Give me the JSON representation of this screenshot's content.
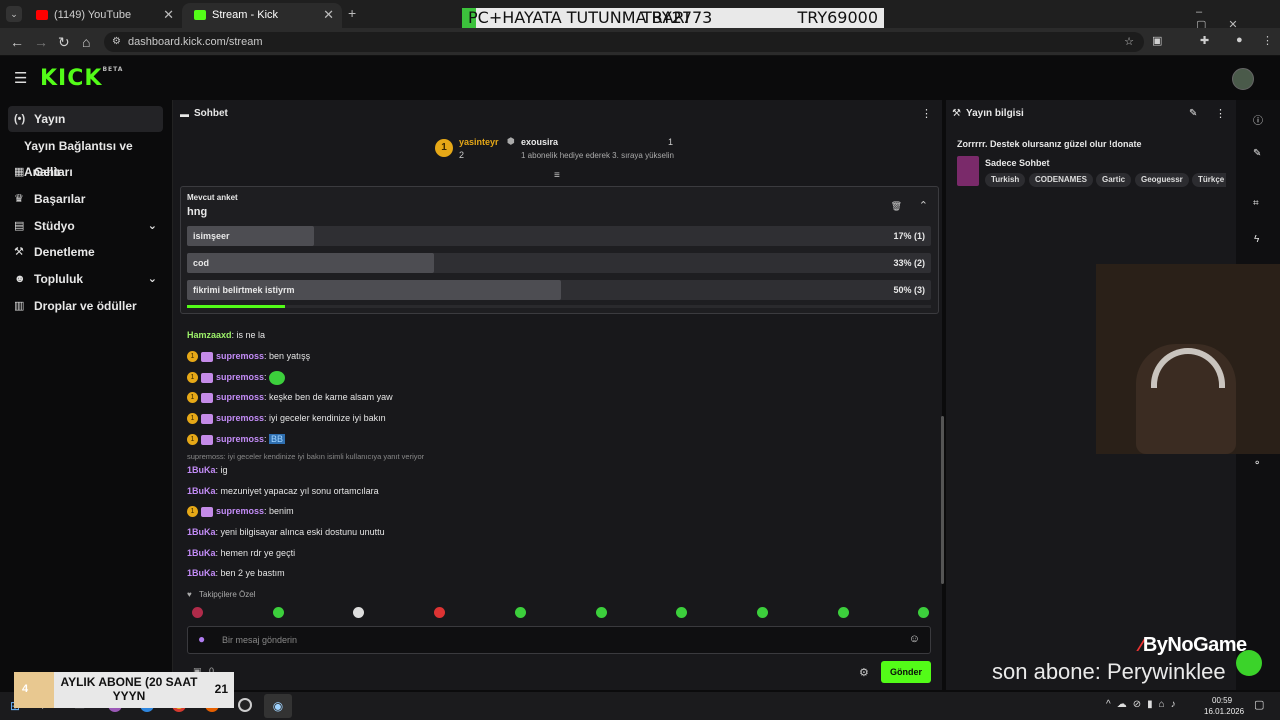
{
  "browser": {
    "tabs": [
      {
        "title": "(1149) YouTube"
      },
      {
        "title": "Stream - Kick Dashboard"
      }
    ],
    "url": "dashboard.kick.com/stream"
  },
  "overlay": {
    "top_text": "PC+HAYATA TUTUNMA BARI",
    "amount_a": "TRY2773",
    "amount_b": "TRY69000",
    "brand": "ByNoGame",
    "last_sub": "son abone: Perywinklee",
    "sub_count": "4",
    "sub_title": "AYLIK ABONE (20 SAAT YYYN",
    "sub_goal": "21"
  },
  "kick": {
    "logo": "KICK",
    "beta": "BETA"
  },
  "sidebar": {
    "items": [
      {
        "label": "Yayın",
        "icon": "broadcast-icon"
      },
      {
        "label": "Yayın Bağlantısı ve Anahtarı"
      },
      {
        "label": "Gelir",
        "icon": "chart-icon"
      },
      {
        "label": "Başarılar",
        "icon": "trophy-icon"
      },
      {
        "label": "Stüdyo",
        "icon": "studio-icon"
      },
      {
        "label": "Denetleme",
        "icon": "wrench-icon"
      },
      {
        "label": "Topluluk",
        "icon": "community-icon"
      },
      {
        "label": "Droplar ve ödüller",
        "icon": "drops-icon"
      }
    ]
  },
  "chat": {
    "title": "Sohbet",
    "leader1": {
      "name": "yasinteyr",
      "count": "2",
      "rank": "1"
    },
    "leader2": {
      "name": "exousira",
      "count": "1",
      "note": "1 abonelik hediye ederek 3. sıraya yükselin"
    },
    "poll": {
      "header": "Mevcut anket",
      "question": "hng",
      "options": [
        {
          "label": "isimşeer",
          "result": "17% (1)",
          "percent": 17
        },
        {
          "label": "cod",
          "result": "33% (2)",
          "percent": 33
        },
        {
          "label": "fikrimi belirtmek istiyrm",
          "result": "50% (3)",
          "percent": 50
        }
      ]
    },
    "messages": [
      {
        "user": "Hamzaaxd",
        "text": "is ne la",
        "badge": false,
        "color": "green"
      },
      {
        "user": "supremoss",
        "text": "ben yatışş",
        "badge": true,
        "color": "purple"
      },
      {
        "user": "supremoss",
        "text": "",
        "badge": true,
        "color": "purple"
      },
      {
        "user": "supremoss",
        "text": "keşke ben de karne alsam yaw",
        "badge": true,
        "color": "purple"
      },
      {
        "user": "supremoss",
        "text": "iyi geceler kendinize iyi bakın",
        "badge": true,
        "color": "purple"
      },
      {
        "user": "supremoss",
        "text": "BB",
        "badge": true,
        "color": "purple"
      },
      {
        "user": "1BuKa",
        "text": "ig",
        "badge": false,
        "color": "purple"
      },
      {
        "user": "1BuKa",
        "text": "mezuniyet yapacaz yıl sonu ortamcılara",
        "badge": false,
        "color": "purple"
      },
      {
        "user": "supremoss",
        "text": "benim",
        "badge": true,
        "color": "purple"
      },
      {
        "user": "1BuKa",
        "text": "yeni bilgisayar alınca eski dostunu unuttu",
        "badge": false,
        "color": "purple"
      },
      {
        "user": "1BuKa",
        "text": "hemen rdr ye geçti",
        "badge": false,
        "color": "purple"
      },
      {
        "user": "1BuKa",
        "text": "ben 2 ye bastım",
        "badge": false,
        "color": "purple"
      }
    ],
    "reply_note": "supremoss: iyi geceler kendinize iyi bakın isimli kullanıcıya yanıt veriyor",
    "emote_section": "Takipçilere Özel",
    "input_placeholder": "Bir mesaj gönderin",
    "send_label": "Gönder",
    "counter": "0"
  },
  "info": {
    "title": "Yayın bilgisi",
    "stream_title": "Zorrrrr. Destek olursanız güzel olur !donate",
    "category": "Sadece Sohbet",
    "tags": [
      "Turkish",
      "CODENAMES",
      "Gartic",
      "Geoguessr",
      "Türkçe"
    ]
  },
  "taskbar": {
    "time": "00:59",
    "date": "16.01.2026"
  },
  "colors": {
    "accent": "#53fc18",
    "panel": "#18181b",
    "bg": "#0b0b0c"
  }
}
